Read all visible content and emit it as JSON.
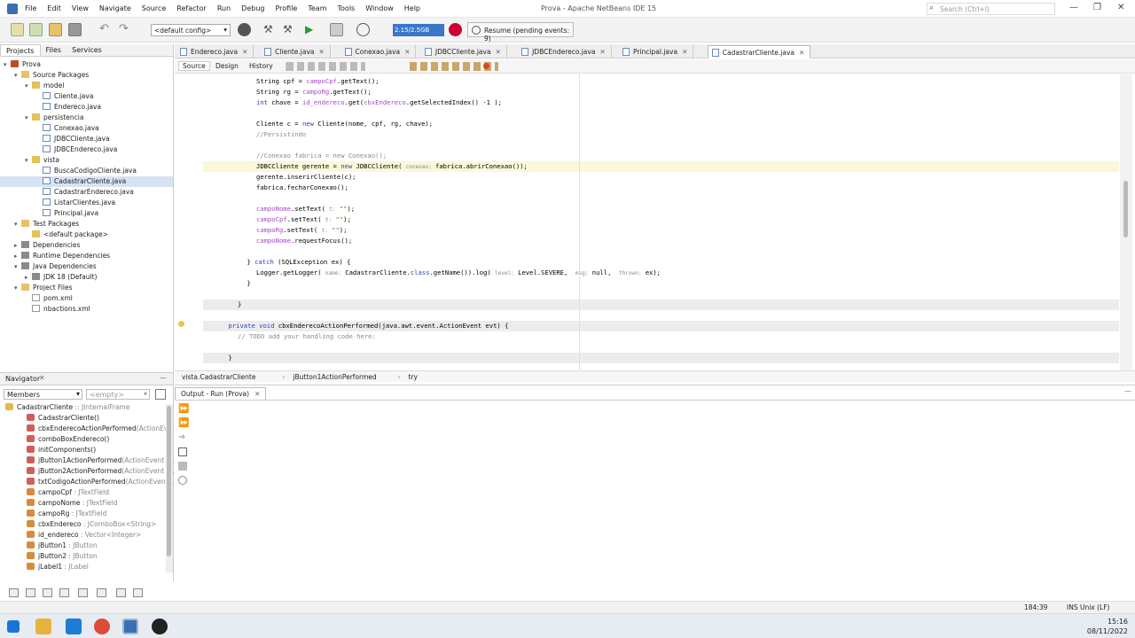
{
  "titlebar": {
    "menus": [
      "File",
      "Edit",
      "View",
      "Navigate",
      "Source",
      "Refactor",
      "Run",
      "Debug",
      "Profile",
      "Team",
      "Tools",
      "Window",
      "Help"
    ],
    "title": "Prova - Apache NetBeans IDE 15",
    "search_placeholder": "Search (Ctrl+I)"
  },
  "toolbar": {
    "config": "<default config>",
    "memory": "2.15/2.5GB",
    "resume": "Resume (pending events: 9)"
  },
  "projects": {
    "tabs": [
      "Projects",
      "Files",
      "Services"
    ],
    "tree": [
      {
        "label": "Prova",
        "indent": 0,
        "icon": "proj",
        "arrow": "▾"
      },
      {
        "label": "Source Packages",
        "indent": 1,
        "icon": "folder",
        "arrow": "▾"
      },
      {
        "label": "model",
        "indent": 2,
        "icon": "pkg",
        "arrow": "▾"
      },
      {
        "label": "Cliente.java",
        "indent": 3,
        "icon": "java",
        "arrow": ""
      },
      {
        "label": "Endereco.java",
        "indent": 3,
        "icon": "java",
        "arrow": ""
      },
      {
        "label": "persistencia",
        "indent": 2,
        "icon": "pkg",
        "arrow": "▾"
      },
      {
        "label": "Conexao.java",
        "indent": 3,
        "icon": "java",
        "arrow": ""
      },
      {
        "label": "JDBCCliente.java",
        "indent": 3,
        "icon": "java",
        "arrow": ""
      },
      {
        "label": "JDBCEndereco.java",
        "indent": 3,
        "icon": "java",
        "arrow": ""
      },
      {
        "label": "vista",
        "indent": 2,
        "icon": "pkg",
        "arrow": "▾"
      },
      {
        "label": "BuscaCodigoCliente.java",
        "indent": 3,
        "icon": "java",
        "arrow": ""
      },
      {
        "label": "CadastrarCliente.java",
        "indent": 3,
        "icon": "java",
        "arrow": "",
        "selected": true
      },
      {
        "label": "CadastrarEndereco.java",
        "indent": 3,
        "icon": "java",
        "arrow": ""
      },
      {
        "label": "ListarClientes.java",
        "indent": 3,
        "icon": "java",
        "arrow": ""
      },
      {
        "label": "Principal.java",
        "indent": 3,
        "icon": "java",
        "arrow": ""
      },
      {
        "label": "Test Packages",
        "indent": 1,
        "icon": "folder",
        "arrow": "▾"
      },
      {
        "label": "<default package>",
        "indent": 2,
        "icon": "pkg",
        "arrow": ""
      },
      {
        "label": "Dependencies",
        "indent": 1,
        "icon": "lib",
        "arrow": "▸"
      },
      {
        "label": "Runtime Dependencies",
        "indent": 1,
        "icon": "lib",
        "arrow": "▸"
      },
      {
        "label": "Java Dependencies",
        "indent": 1,
        "icon": "lib",
        "arrow": "▾"
      },
      {
        "label": "JDK 18 (Default)",
        "indent": 2,
        "icon": "lib",
        "arrow": "▸"
      },
      {
        "label": "Project Files",
        "indent": 1,
        "icon": "folder",
        "arrow": "▾"
      },
      {
        "label": "pom.xml",
        "indent": 2,
        "icon": "xml",
        "arrow": ""
      },
      {
        "label": "nbactions.xml",
        "indent": 2,
        "icon": "xml",
        "arrow": ""
      }
    ]
  },
  "editor": {
    "tabs": [
      "Endereco.java",
      "Cliente.java",
      "Conexao.java",
      "JDBCCliente.java",
      "JDBCEndereco.java",
      "Principal.java",
      "CadastrarCliente.java"
    ],
    "active_tab": "CadastrarCliente.java",
    "views": [
      "Source",
      "Design",
      "History"
    ],
    "breadcrumb": [
      "vista.CadastrarCliente",
      "jButton1ActionPerformed",
      "try"
    ]
  },
  "code_lines": [
    "String cpf = campoCpf.getText();",
    "String rg = campoRg.getText();",
    "int chave = id_endereco.get(cbxEndereco.getSelectedIndex() -1 );",
    "",
    "Cliente c = new Cliente(nome, cpf, rg, chave);",
    "//Persistindo",
    "",
    "//Conexao fabrica = new Conexao();",
    "JDBCCliente gerente = new JDBCCliente( conexao: fabrica.abrirConexao());",
    "gerente.inserirCliente(c);",
    "fabrica.fecharConexao();",
    "",
    "campoNome.setText( t: \"\");",
    "campoCpf.setText( t: \"\");",
    "campoRg.setText( t: \"\");",
    "campoNome.requestFocus();",
    "",
    "} catch (SQLException ex) {",
    "Logger.getLogger( name: CadastrarCliente.class.getName()).log( level: Level.SEVERE,  msg: null,  thrown: ex);",
    "}",
    "",
    "}",
    "",
    "private void cbxEnderecoActionPerformed(java.awt.event.ActionEvent evt) {",
    "// TODO add your handling code here:",
    "",
    "}"
  ],
  "navigator": {
    "title": "Navigator",
    "filter": "Members",
    "filter2": "<empty>",
    "items": [
      {
        "name": "CadastrarCliente",
        "type": " :: JInternalFrame",
        "icon": "c"
      },
      {
        "name": "CadastrarCliente()",
        "type": "",
        "icon": "m"
      },
      {
        "name": "cbxEnderecoActionPerformed",
        "type": "(ActionEv...",
        "icon": "m"
      },
      {
        "name": "comboBoxEndereco()",
        "type": "",
        "icon": "m"
      },
      {
        "name": "initComponents()",
        "type": "",
        "icon": "m"
      },
      {
        "name": "jButton1ActionPerformed",
        "type": "(ActionEvent e...",
        "icon": "m"
      },
      {
        "name": "jButton2ActionPerformed",
        "type": "(ActionEvent e...",
        "icon": "m"
      },
      {
        "name": "txtCodigoActionPerformed",
        "type": "(ActionEvent...",
        "icon": "m"
      },
      {
        "name": "campoCpf",
        "type": " : JTextField",
        "icon": "f"
      },
      {
        "name": "campoNome",
        "type": " : JTextField",
        "icon": "f"
      },
      {
        "name": "campoRg",
        "type": " : JTextField",
        "icon": "f"
      },
      {
        "name": "cbxEndereco",
        "type": " : JComboBox<String>",
        "icon": "f"
      },
      {
        "name": "id_endereco",
        "type": " : Vector<Integer>",
        "icon": "f"
      },
      {
        "name": "jButton1",
        "type": " : JButton",
        "icon": "f"
      },
      {
        "name": "jButton2",
        "type": " : JButton",
        "icon": "f"
      },
      {
        "name": "jLabel1",
        "type": " : JLabel",
        "icon": "f"
      }
    ]
  },
  "output": {
    "tab": "Output - Run (Prova)"
  },
  "status": {
    "position": "184:39",
    "mode": "INS Unix (LF)"
  },
  "clock": {
    "time": "15:16",
    "date": "08/11/2022"
  },
  "colors": {
    "accent": "#3a77c8",
    "selection": "#d7e3f4",
    "current_line": "#fbf7d9"
  }
}
